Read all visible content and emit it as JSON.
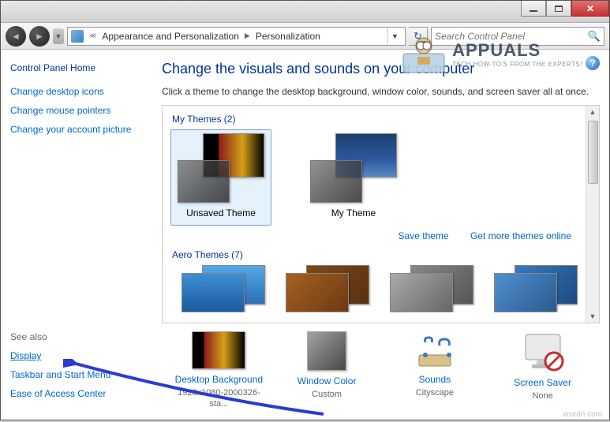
{
  "breadcrumb": {
    "level1": "Appearance and Personalization",
    "level2": "Personalization"
  },
  "search": {
    "placeholder": "Search Control Panel"
  },
  "sidebar": {
    "home": "Control Panel Home",
    "links": [
      "Change desktop icons",
      "Change mouse pointers",
      "Change your account picture"
    ],
    "seealso_header": "See also",
    "seealso": [
      "Display",
      "Taskbar and Start Menu",
      "Ease of Access Center"
    ]
  },
  "main": {
    "title": "Change the visuals and sounds on your computer",
    "description": "Click a theme to change the desktop background, window color, sounds, and screen saver all at once."
  },
  "themes": {
    "my_themes_header": "My Themes (2)",
    "items": [
      {
        "label": "Unsaved Theme",
        "selected": true
      },
      {
        "label": "My Theme",
        "selected": false
      }
    ],
    "save_link": "Save theme",
    "more_link": "Get more themes online",
    "aero_header": "Aero Themes (7)"
  },
  "bottom": {
    "bg": {
      "label": "Desktop Background",
      "value": "1920x1080-2000326-sta..."
    },
    "wc": {
      "label": "Window Color",
      "value": "Custom"
    },
    "snd": {
      "label": "Sounds",
      "value": "Cityscape"
    },
    "ss": {
      "label": "Screen Saver",
      "value": "None"
    }
  },
  "watermark": {
    "brand": "APPUALS",
    "sub": "TECH HOW-TO'S FROM THE EXPERTS!"
  },
  "footer": "wsxdn.com"
}
